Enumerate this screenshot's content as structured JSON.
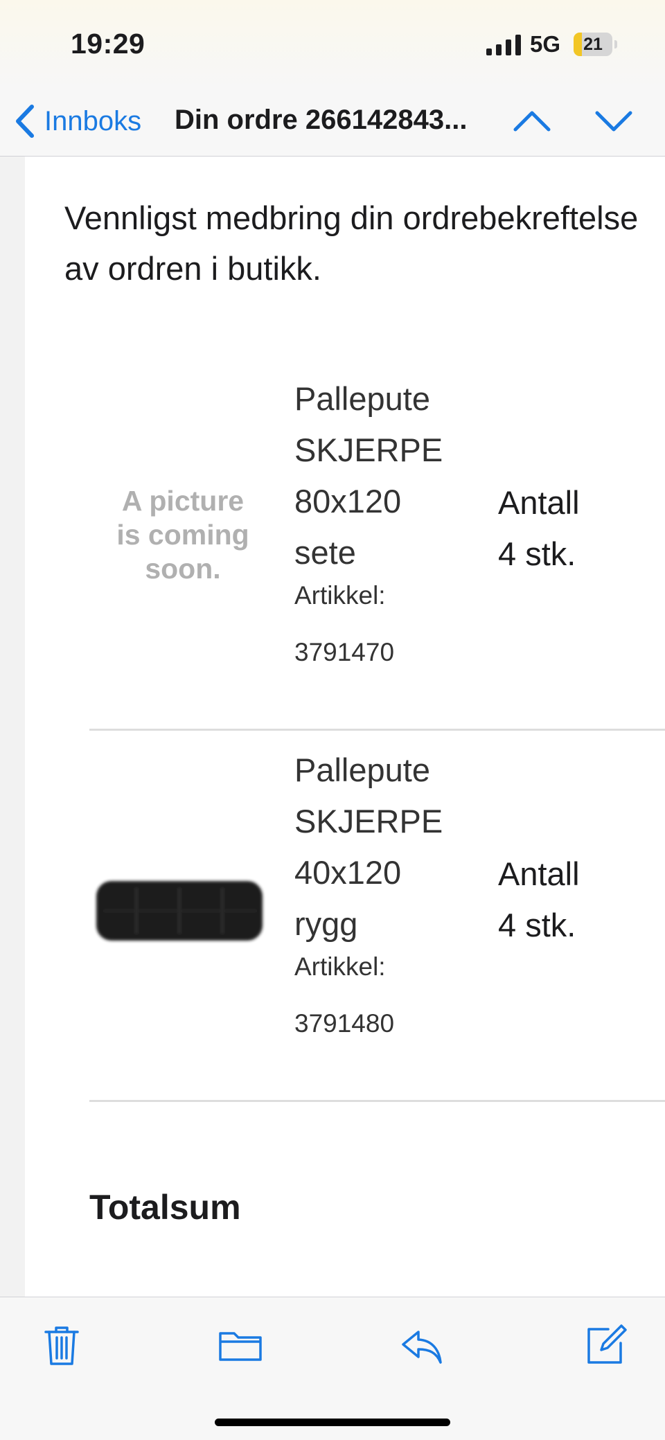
{
  "status_bar": {
    "time": "19:29",
    "network": "5G",
    "battery_level": "21",
    "battery_percent": 21,
    "battery_color": "#f2c625",
    "signal_icon": "cellular-signal-icon"
  },
  "nav": {
    "back_label": "Innboks",
    "title": "Din ordre 266142843...",
    "back_icon": "chevron-left-icon",
    "up_icon": "chevron-up-icon",
    "down_icon": "chevron-down-icon",
    "accent_color": "#1a7ae2"
  },
  "message": {
    "intro_lines": [
      "Vennligst medbring din ordrebekreftelse",
      "av ordren i butikk."
    ],
    "items": [
      {
        "image_placeholder": [
          "A picture",
          "is coming",
          "soon."
        ],
        "name_lines": [
          "Pallepute",
          "SKJERPE",
          "80x120",
          "sete"
        ],
        "sku_label": "Artikkel:",
        "sku": "3791470",
        "qty_label": "Antall",
        "qty": "4 stk."
      },
      {
        "image": "black-cushion-image",
        "name_lines": [
          "Pallepute",
          "SKJERPE",
          "40x120",
          "rygg"
        ],
        "sku_label": "Artikkel:",
        "sku": "3791480",
        "qty_label": "Antall",
        "qty": "4 stk."
      }
    ],
    "totals_label": "Totalsum"
  },
  "toolbar": {
    "icons": [
      "trash-icon",
      "folder-icon",
      "reply-icon",
      "compose-icon"
    ]
  }
}
